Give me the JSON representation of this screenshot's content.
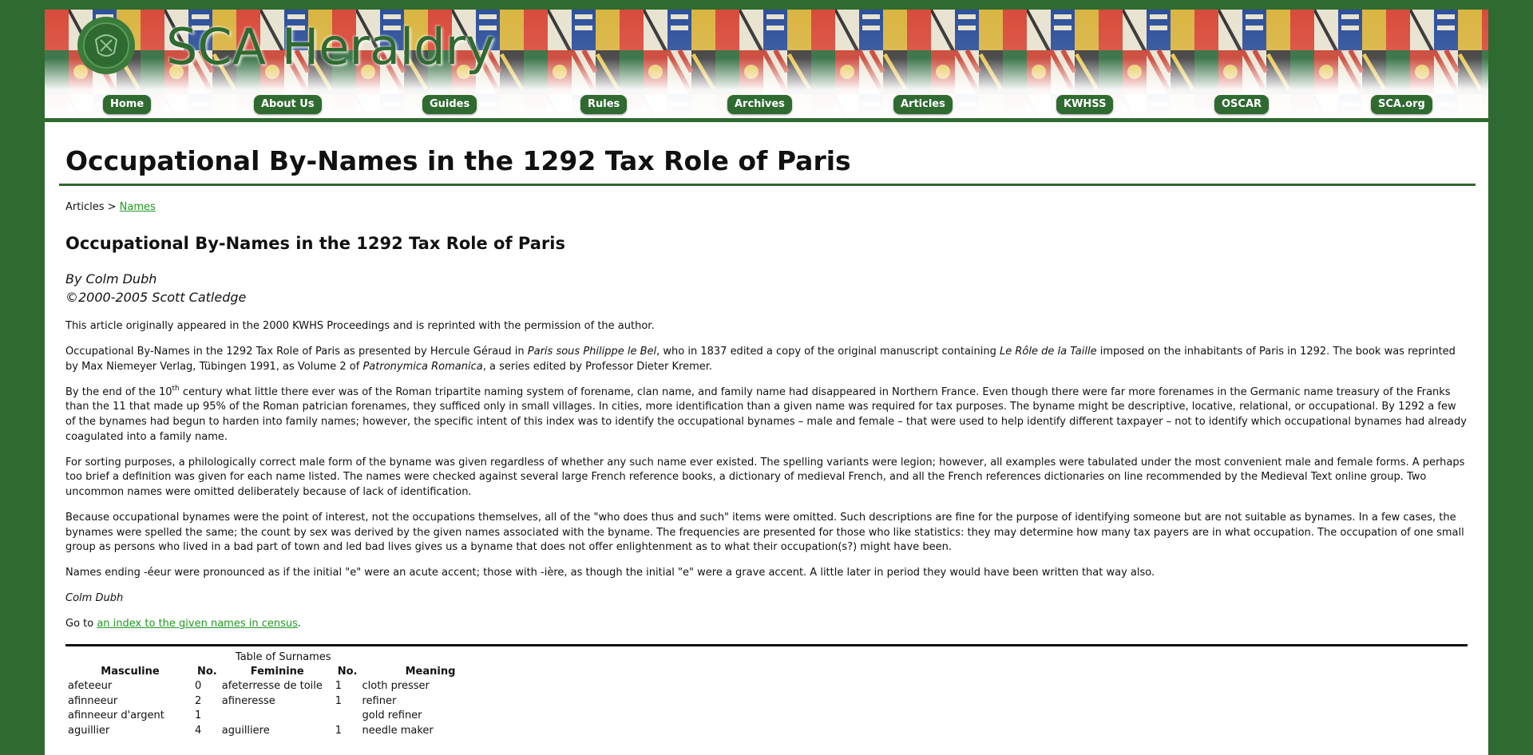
{
  "site": {
    "title": "SCA Heraldry",
    "logo_icon": "seal-icon",
    "colors": {
      "brand_green": "#2f6a30",
      "link_green": "#1f9a1f",
      "background": "#2f6a30"
    }
  },
  "nav": {
    "items": [
      {
        "label": "Home"
      },
      {
        "label": "About Us"
      },
      {
        "label": "Guides"
      },
      {
        "label": "Rules"
      },
      {
        "label": "Archives"
      },
      {
        "label": "Articles"
      },
      {
        "label": "KWHSS"
      },
      {
        "label": "OSCAR"
      },
      {
        "label": "SCA.org"
      }
    ]
  },
  "page": {
    "title": "Occupational By-Names in the 1292 Tax Role of Paris",
    "breadcrumb": {
      "root": "Articles",
      "separator": ">",
      "link": "Names"
    }
  },
  "article": {
    "title": "Occupational By-Names in the 1292 Tax Role of Paris",
    "author_line": "By Colm Dubh",
    "copyright_line": "©2000-2005 Scott Catledge",
    "p1": "This article originally appeared in the 2000 KWHS Proceedings and is reprinted with the permission of the author.",
    "p2": {
      "a": "Occupational By-Names in the 1292 Tax Role of Paris as presented by Hercule Géraud in ",
      "b_italic": "Paris sous Philippe le Bel",
      "c": ", who in 1837 edited a copy of the original manuscript containing ",
      "d_italic": "Le Rôle de la Taille",
      "e": " imposed on the inhabitants of Paris in 1292. The book was reprinted by Max Niemeyer Verlag, Tübingen 1991, as Volume 2 of ",
      "f_italic": "Patronymica Romanica",
      "g": ", a series edited by Professor Dieter Kremer."
    },
    "p3": {
      "a": "By the end of the 10",
      "sup": "th",
      "b": " century what little there ever was of the Roman tripartite naming system of forename, clan name, and family name had disappeared in Northern France. Even though there were far more forenames in the Germanic name treasury of the Franks than the 11 that made up 95% of the Roman patrician forenames, they sufficed only in small villages. In cities, more identification than a given name was required for tax purposes. The byname might be descriptive, locative, relational, or occupational. By 1292 a few of the bynames had begun to harden into family names; however, the specific intent of this index was to identify the occupational bynames – male and female – that were used to help identify different taxpayer – not to identify which occupational bynames had already coagulated into a family name."
    },
    "p4": "For sorting purposes, a philologically correct male form of the byname was given regardless of whether any such name ever existed. The spelling variants were legion; however, all examples were tabulated under the most convenient male and female forms. A perhaps too brief a definition was given for each name listed. The names were checked against several large French reference books, a dictionary of medieval French, and all the French references dictionaries on line recommended by the Medieval Text online group. Two uncommon names were omitted deliberately because of lack of identification.",
    "p5": "Because occupational bynames were the point of interest, not the occupations themselves, all of the \"who does thus and such\" items were omitted. Such descriptions are fine for the purpose of identifying someone but are not suitable as bynames. In a few cases, the bynames were spelled the same; the count by sex was derived by the given names associated with the byname. The frequencies are presented for those who like statistics: they may determine how many tax payers are in what occupation. The occupation of one small group as persons who lived in a bad part of town and led bad lives gives us a byname that does not offer enlightenment as to what their occupation(s?) might have been.",
    "p6": "Names ending -éeur were pronounced as if the initial \"e\" were an acute accent; those with -ière, as though the initial \"e\" were a grave accent. A little later in period they would have been written that way also.",
    "signature": "Colm Dubh",
    "goto": {
      "prefix": "Go to ",
      "link": "an index to the given names in census",
      "suffix": "."
    }
  },
  "table": {
    "caption": "Table of Surnames",
    "headers": [
      "Masculine",
      "No.",
      "Feminine",
      "No.",
      "Meaning"
    ],
    "rows": [
      [
        "afeteeur",
        "0",
        "afeterresse de toile",
        "1",
        "cloth presser"
      ],
      [
        "afinneeur",
        "2",
        "afineresse",
        "1",
        "refiner"
      ],
      [
        "afinneeur d'argent",
        "1",
        "",
        "",
        "gold refiner"
      ],
      [
        "aguillier",
        "4",
        "aguilliere",
        "1",
        "needle maker"
      ]
    ]
  }
}
